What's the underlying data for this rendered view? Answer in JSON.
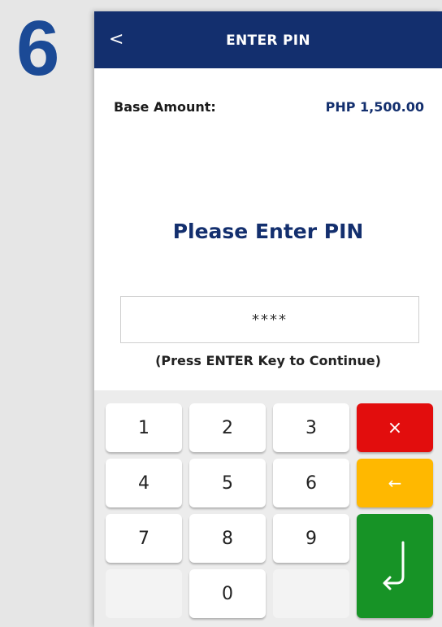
{
  "step": {
    "number": "6"
  },
  "header": {
    "back_label": "<",
    "title": "ENTER PIN"
  },
  "amount": {
    "label": "Base Amount:",
    "value": "PHP 1,500.00"
  },
  "prompt": {
    "text": "Please Enter PIN"
  },
  "pin_field": {
    "value": "****"
  },
  "hint": {
    "text": "(Press ENTER Key to Continue)"
  },
  "keypad": {
    "k1": "1",
    "k2": "2",
    "k3": "3",
    "k4": "4",
    "k5": "5",
    "k6": "6",
    "k7": "7",
    "k8": "8",
    "k9": "9",
    "k0": "0",
    "cancel": "×",
    "backspace": "←"
  },
  "colors": {
    "brand_navy": "#132f6e",
    "cancel_red": "#e20d0d",
    "backspace_amber": "#ffb800",
    "enter_green": "#179326"
  },
  "icons": {
    "enter": "enter-return-icon",
    "cancel": "close-icon",
    "backspace": "arrow-left-icon"
  }
}
